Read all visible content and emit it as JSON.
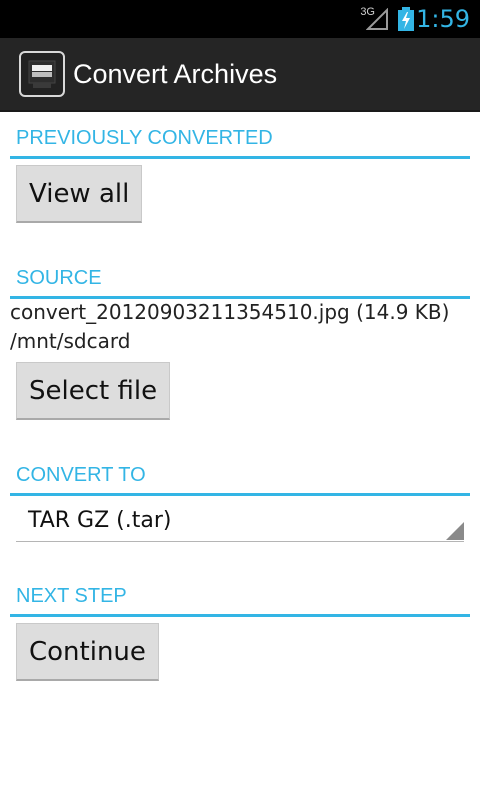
{
  "status_bar": {
    "network": "3G",
    "time": "1:59",
    "icons": [
      "signal-icon",
      "battery-charging-icon"
    ]
  },
  "action_bar": {
    "icon": "archive-app-icon",
    "title": "Convert Archives"
  },
  "sections": {
    "previously_converted": {
      "label": "PREVIOUSLY CONVERTED",
      "button_label": "View all"
    },
    "source": {
      "label": "SOURCE",
      "file_info": "convert_20120903211354510.jpg (14.9 KB)",
      "path": "/mnt/sdcard",
      "button_label": "Select file"
    },
    "convert_to": {
      "label": "CONVERT TO",
      "selected": "TAR GZ (.tar)"
    },
    "next_step": {
      "label": "NEXT STEP",
      "button_label": "Continue"
    }
  },
  "colors": {
    "accent": "#33b5e5",
    "action_bar": "#252525",
    "status_bar": "#000000",
    "button": "#dddddd"
  }
}
